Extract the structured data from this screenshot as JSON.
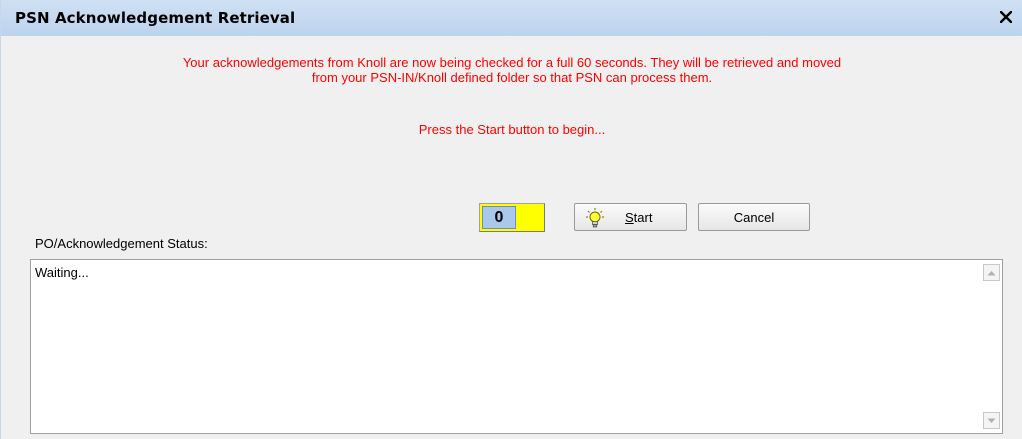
{
  "window": {
    "title": "PSN Acknowledgement Retrieval",
    "close_icon": "close-icon"
  },
  "message": {
    "line1": "Your acknowledgements from Knoll are now being checked for a full 60 seconds.  They will be retrieved and moved",
    "line2": "from your PSN-IN/Knoll defined folder so that PSN can process them.",
    "prompt": "Press the Start button to begin..."
  },
  "counter": {
    "value": "0"
  },
  "buttons": {
    "start_underlined": "S",
    "start_rest": "tart",
    "start_icon": "lightbulb-icon",
    "cancel": "Cancel"
  },
  "status": {
    "label": "PO/Acknowledgement Status:",
    "text": "Waiting..."
  },
  "colors": {
    "message_text": "#ff0000",
    "counter_background": "#ffff00",
    "titlebar": "#c4d8f0"
  }
}
